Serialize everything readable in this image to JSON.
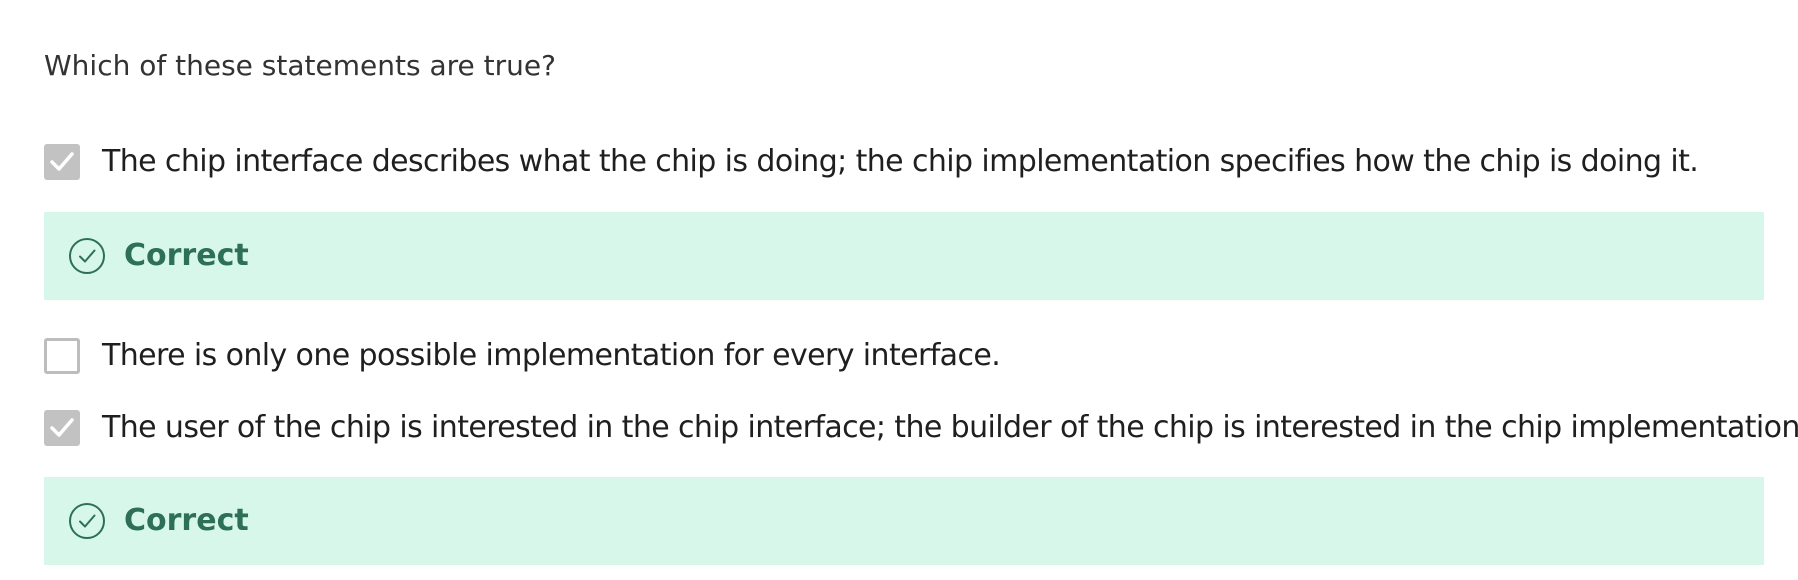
{
  "question": {
    "text": "Which of these statements are true?"
  },
  "options": [
    {
      "label": "The chip interface describes what the chip is doing; the chip implementation specifies how the chip is doing it.",
      "checked": true,
      "feedback": "Correct"
    },
    {
      "label": "There is only one possible implementation for every interface.",
      "checked": false
    },
    {
      "label": "The user of the chip is interested in the chip interface; the builder of the chip is interested in the chip implementation.",
      "checked": true,
      "feedback": "Correct"
    }
  ],
  "icons": {
    "checkbox_checked": "checkmark-icon",
    "feedback_correct": "check-circle-icon"
  },
  "colors": {
    "feedback_background": "#d7f7ea",
    "feedback_text": "#2e7057",
    "checkbox_checked": "#c2c2c2",
    "checkbox_border": "#bdbdbd"
  }
}
